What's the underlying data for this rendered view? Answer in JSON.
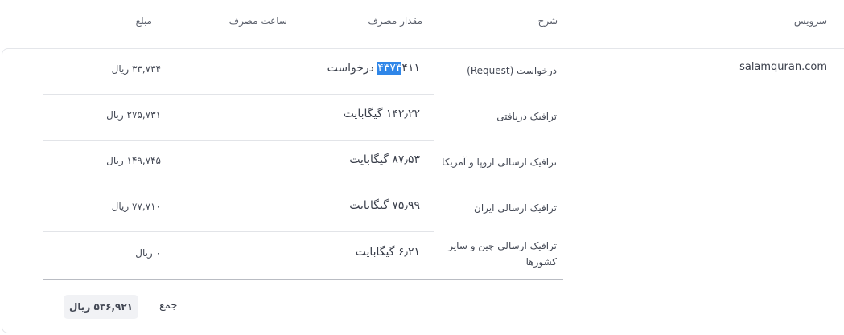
{
  "header": {
    "service": "سرویس",
    "description": "شرح",
    "usage": "مقدار مصرف",
    "usage_hours": "ساعت مصرف",
    "amount": "مبلغ"
  },
  "service_name": "salamquran.com",
  "rows": [
    {
      "description": "درخواست (Request)",
      "usage_pre": "",
      "usage_highlight": "۴۳۷۳",
      "usage_post": "۴۱۱ درخواست",
      "amount": "۳۳,۷۳۴ ریال"
    },
    {
      "description": "ترافیک دریافتی",
      "usage": "۱۴۲٫۲۲ گیگابایت",
      "amount": "۲۷۵,۷۳۱ ریال"
    },
    {
      "description": "ترافیک ارسالی اروپا و آمریکا",
      "usage": "۸۷٫۵۳ گیگابایت",
      "amount": "۱۴۹,۷۴۵ ریال"
    },
    {
      "description": "ترافیک ارسالی ایران",
      "usage": "۷۵٫۹۹ گیگابایت",
      "amount": "۷۷,۷۱۰ ریال"
    },
    {
      "description": "ترافیک ارسالی چین و سایر کشورها",
      "usage": "۶٫۲۱ گیگابایت",
      "amount": "۰ ریال"
    }
  ],
  "total": {
    "label": "جمع",
    "amount": "۵۳۶,۹۲۱ ریال"
  }
}
